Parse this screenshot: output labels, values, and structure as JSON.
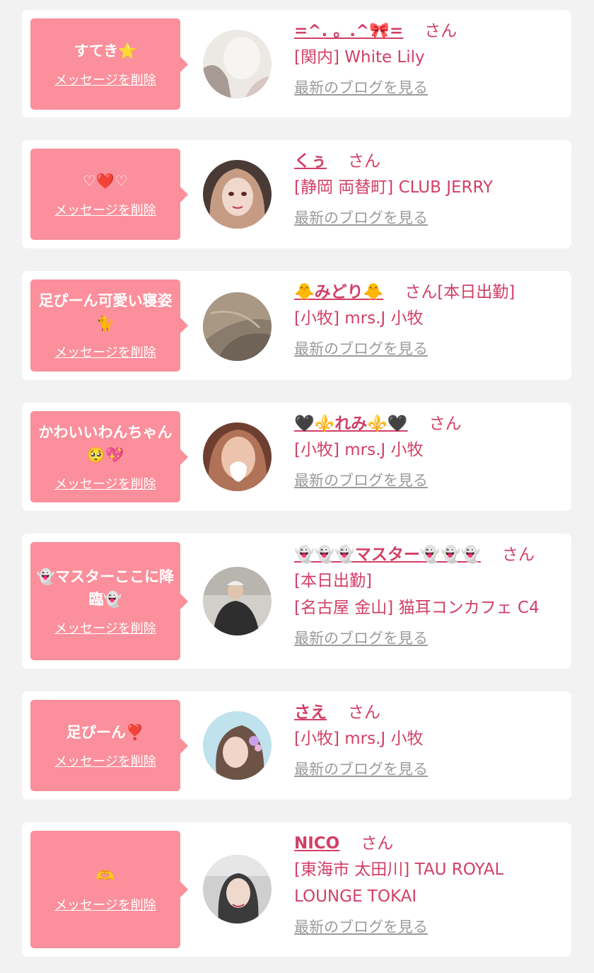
{
  "cards": [
    {
      "message": "すてき⭐",
      "delete_label": "メッセージを削除",
      "name": "=^. 。.^🎀=",
      "san": "さん",
      "status": "",
      "shop": "[関内] White Lily",
      "blog_label": "最新のブログを見る",
      "avatar_colors": [
        "#e8e4e0",
        "#b9ada8"
      ]
    },
    {
      "message": "♡❤️♡",
      "delete_label": "メッセージを削除",
      "name": "くぅ",
      "san": "さん",
      "status": "",
      "shop": "[静岡 両替町] CLUB JERRY",
      "blog_label": "最新のブログを見る",
      "avatar_colors": [
        "#c8a894",
        "#4a3a36"
      ]
    },
    {
      "message": "足ぴーん可愛い寝姿🐈",
      "delete_label": "メッセージを削除",
      "name": "🐥みどり🐥",
      "san": "さん",
      "status": "[本日出勤]",
      "shop": "[小牧] mrs.J 小牧",
      "blog_label": "最新のブログを見る",
      "avatar_colors": [
        "#9c8c78",
        "#6e6356"
      ]
    },
    {
      "message": "かわいいわんちゃん🥺💖",
      "delete_label": "メッセージを削除",
      "name": "🖤⚜️れみ⚜️🖤",
      "san": "さん",
      "status": "",
      "shop": "[小牧] mrs.J 小牧",
      "blog_label": "最新のブログを見る",
      "avatar_colors": [
        "#d9a98c",
        "#7b4a3a"
      ]
    },
    {
      "message": "👻マスターここに降臨👻",
      "delete_label": "メッセージを削除",
      "name": "👻👻👻マスター👻👻👻",
      "san": "さん",
      "status": "[本日出勤]",
      "shop": "[名古屋 金山] 猫耳コンカフェ C4",
      "blog_label": "最新のブログを見る",
      "avatar_colors": [
        "#c9c7c3",
        "#3a3a3a"
      ]
    },
    {
      "message": "足ぴーん❣️",
      "delete_label": "メッセージを削除",
      "name": "さえ",
      "san": "さん",
      "status": "",
      "shop": "[小牧] mrs.J 小牧",
      "blog_label": "最新のブログを見る",
      "avatar_colors": [
        "#b9dde8",
        "#6d5246"
      ]
    },
    {
      "message": "🫶",
      "delete_label": "メッセージを削除",
      "name": "NICO",
      "san": "さん",
      "status": "",
      "shop": "[東海市 太田川] TAU ROYAL LOUNGE TOKAI",
      "blog_label": "最新のブログを見る",
      "avatar_colors": [
        "#cfcfcf",
        "#3b3b3b"
      ]
    }
  ]
}
